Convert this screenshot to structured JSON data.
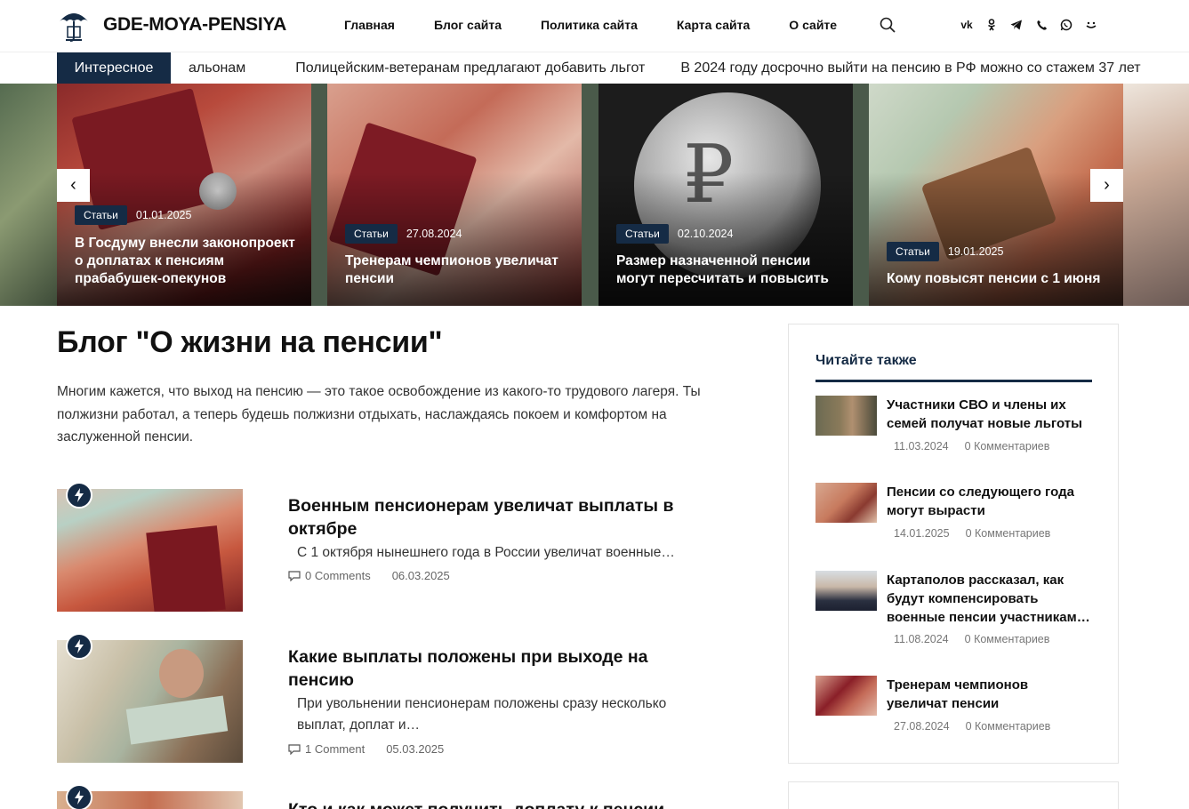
{
  "site": {
    "name": "GDE-MOYA-PENSIYA",
    "nav": [
      "Главная",
      "Блог сайта",
      "Политика сайта",
      "Карта сайта",
      "О сайте"
    ],
    "socials": [
      "vk-icon",
      "odnoklassniki-icon",
      "telegram-icon",
      "viber-icon",
      "whatsapp-icon",
      "moikrug-icon"
    ],
    "accent": "#152b45"
  },
  "ticker": {
    "label": "Интересное",
    "items": [
      "альонам",
      "Полицейским-ветеранам предлагают добавить льгот",
      "В 2024 году досрочно выйти на пенсию в РФ можно со стажем 37 лет"
    ]
  },
  "slider": {
    "prev": "‹",
    "next": "›",
    "slides": [
      {
        "category": "Статьи",
        "date": "01.01.2025",
        "title": "В Госдуму внесли законопроект о доплатах к пенсиям прабабушек-опекунов"
      },
      {
        "category": "Статьи",
        "date": "27.08.2024",
        "title": "Тренерам чемпионов увеличат пенсии"
      },
      {
        "category": "Статьи",
        "date": "02.10.2024",
        "title": "Размер назначенной пенсии могут пересчитать и повысить"
      },
      {
        "category": "Статьи",
        "date": "19.01.2025",
        "title": "Кому повысят пенсии с 1 июня"
      }
    ]
  },
  "blog": {
    "title": "Блог \"О жизни на пенсии\"",
    "intro": "Многим кажется, что выход на пенсию — это такое освобождение из какого-то трудового лагеря. Ты полжизни работал, а теперь будешь полжизни отдыхать, наслаждаясь покоем и комфортом на заслуженной пенсии.",
    "posts": [
      {
        "title": "Военным пенсионерам увеличат выплаты в октябре",
        "excerpt": "С 1 октября нынешнего года в России увеличат военные…",
        "comments": "0 Comments",
        "date": "06.03.2025"
      },
      {
        "title": "Какие выплаты положены при выходе на пенсию",
        "excerpt": "При увольнении пенсионерам положены сразу несколько выплат, доплат и…",
        "comments": "1 Comment",
        "date": "05.03.2025"
      },
      {
        "title": "Кто и как может получить доплату к пенсии",
        "excerpt": "",
        "comments": "",
        "date": ""
      }
    ]
  },
  "sidebar": {
    "heading": "Читайте также",
    "items": [
      {
        "title": "Участники СВО и члены их семей получат новые льготы",
        "date": "11.03.2024",
        "comments": "0 Комментариев"
      },
      {
        "title": "Пенсии со следующего года могут вырасти",
        "date": "14.01.2025",
        "comments": "0 Комментариев"
      },
      {
        "title": "Картаполов рассказал, как будут компенсировать военные пенсии участникам…",
        "date": "11.08.2024",
        "comments": "0 Комментариев"
      },
      {
        "title": "Тренерам чемпионов увеличат пенсии",
        "date": "27.08.2024",
        "comments": "0 Комментариев"
      }
    ]
  }
}
